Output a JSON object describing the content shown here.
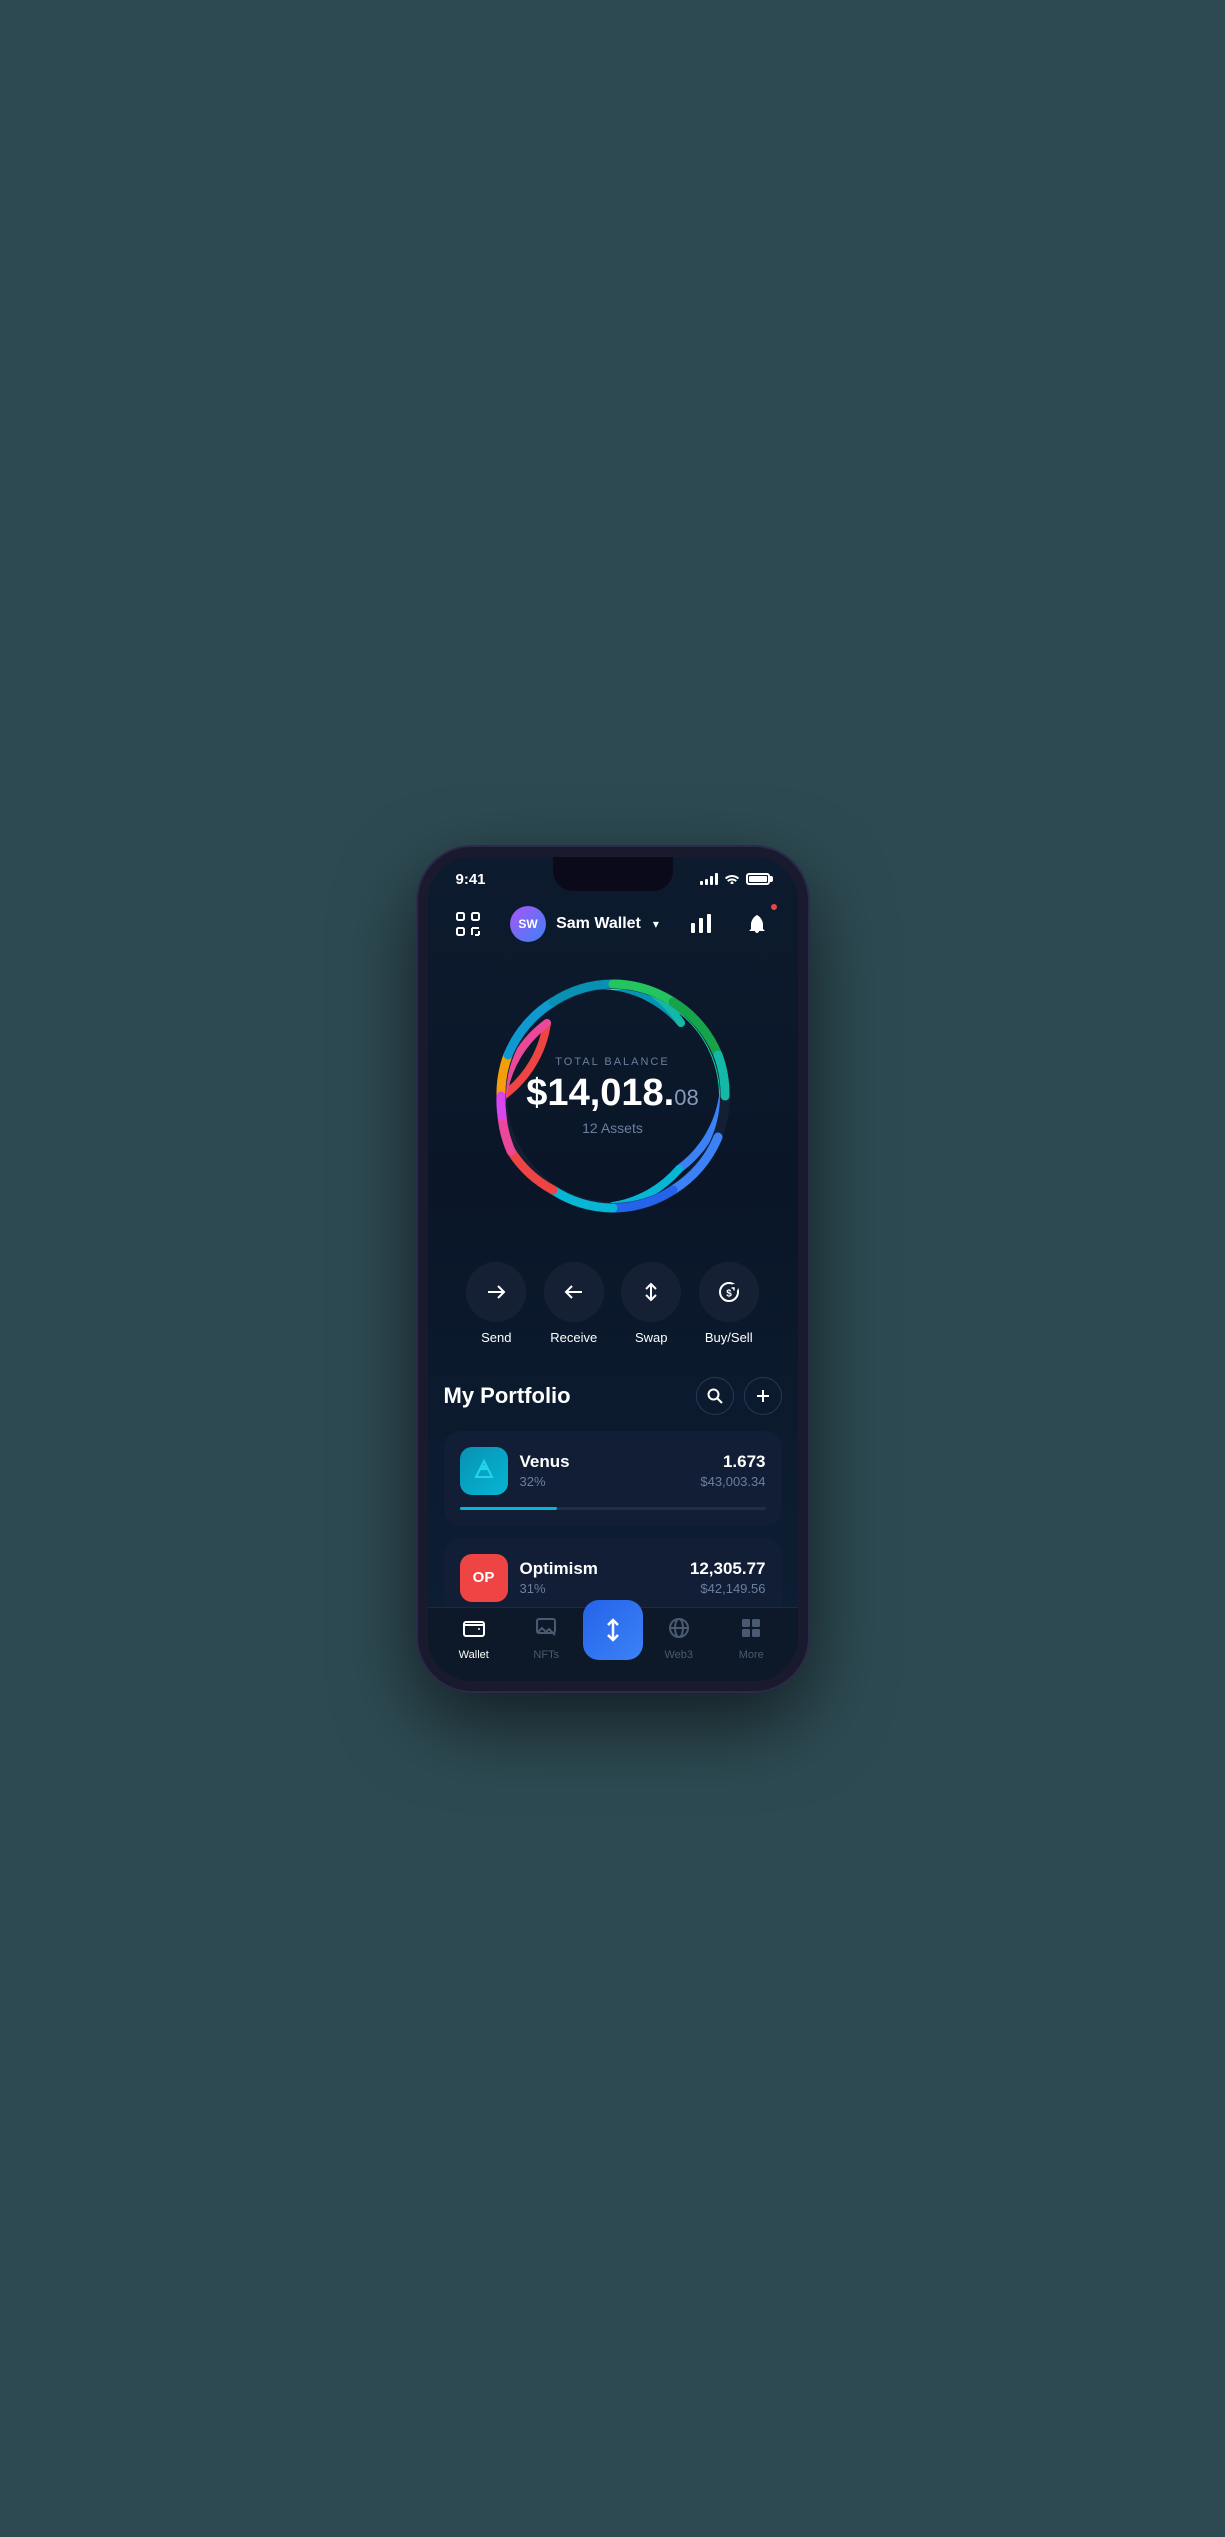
{
  "statusBar": {
    "time": "9:41"
  },
  "header": {
    "userInitials": "SW",
    "userName": "Sam Wallet",
    "scanIconLabel": "scan-icon",
    "chartIconLabel": "chart-icon",
    "notificationIconLabel": "notification-icon"
  },
  "balance": {
    "label": "TOTAL BALANCE",
    "amountMain": "$14,018.",
    "amountCents": "08",
    "assetsLabel": "12 Assets"
  },
  "actions": [
    {
      "id": "send",
      "label": "Send"
    },
    {
      "id": "receive",
      "label": "Receive"
    },
    {
      "id": "swap",
      "label": "Swap"
    },
    {
      "id": "buysell",
      "label": "Buy/Sell"
    }
  ],
  "portfolio": {
    "title": "My Portfolio",
    "searchLabel": "search-button",
    "addLabel": "add-button"
  },
  "assets": [
    {
      "id": "venus",
      "name": "Venus",
      "percent": "32%",
      "amount": "1.673",
      "value": "$43,003.34",
      "barColor": "#06b6d4",
      "barWidth": "32"
    },
    {
      "id": "optimism",
      "name": "Optimism",
      "percent": "31%",
      "amount": "12,305.77",
      "value": "$42,149.56",
      "barColor": "#ef4444",
      "barWidth": "31"
    }
  ],
  "bottomNav": [
    {
      "id": "wallet",
      "label": "Wallet",
      "active": true
    },
    {
      "id": "nfts",
      "label": "NFTs",
      "active": false
    },
    {
      "id": "swap-center",
      "label": "",
      "active": false,
      "isCenter": true
    },
    {
      "id": "web3",
      "label": "Web3",
      "active": false
    },
    {
      "id": "more",
      "label": "More",
      "active": false
    }
  ]
}
